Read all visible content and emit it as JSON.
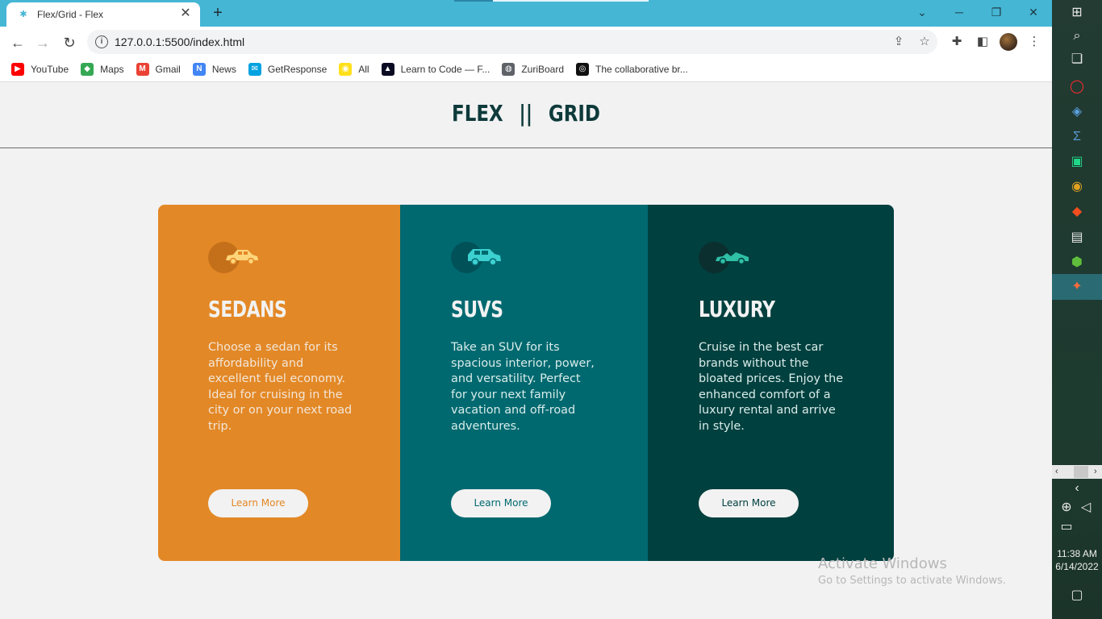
{
  "browser": {
    "tab_title": "Flex/Grid - Flex",
    "tab_close": "✕",
    "new_tab": "+",
    "url": "127.0.0.1:5500/index.html",
    "bookmarks": [
      {
        "label": "YouTube",
        "icon": "youtube-icon",
        "color": "#ff0000",
        "glyph": "▶"
      },
      {
        "label": "Maps",
        "icon": "maps-icon",
        "color": "#34a853",
        "glyph": "◆"
      },
      {
        "label": "Gmail",
        "icon": "gmail-icon",
        "color": "#ea4335",
        "glyph": "M"
      },
      {
        "label": "News",
        "icon": "news-icon",
        "color": "#4285f4",
        "glyph": "N"
      },
      {
        "label": "GetResponse",
        "icon": "getresponse-icon",
        "color": "#00a2e0",
        "glyph": "✉"
      },
      {
        "label": "All",
        "icon": "mailchimp-icon",
        "color": "#ffe01b",
        "glyph": "◉"
      },
      {
        "label": "Learn to Code — F...",
        "icon": "freecodecamp-icon",
        "color": "#0a0a23",
        "glyph": "▲"
      },
      {
        "label": "ZuriBoard",
        "icon": "globe-icon",
        "color": "#5f6368",
        "glyph": "◍"
      },
      {
        "label": "The collaborative br...",
        "icon": "collab-icon",
        "color": "#111111",
        "glyph": "◎"
      }
    ]
  },
  "page": {
    "logo_left": "FLEX",
    "logo_sep": "||",
    "logo_right": "GRID",
    "cards": [
      {
        "title": "SEDANS",
        "text": "Choose a sedan for its affordability and excellent fuel economy. Ideal for cruising in the city or on your next road trip.",
        "button": "Learn More",
        "color": "#e38826"
      },
      {
        "title": "SUVS",
        "text": "Take an SUV for its spacious interior, power, and versatility. Perfect for your next family vacation and off-road adventures.",
        "button": "Learn More",
        "color": "#006970"
      },
      {
        "title": "LUXURY",
        "text": "Cruise in the best car brands without the bloated prices. Enjoy the enhanced comfort of a luxury rental and arrive in style.",
        "button": "Learn More",
        "color": "#00403f"
      }
    ]
  },
  "watermark": {
    "line1": "Activate Windows",
    "line2": "Go to Settings to activate Windows."
  },
  "taskbar": {
    "time": "11:38 AM",
    "date": "6/14/2022"
  }
}
